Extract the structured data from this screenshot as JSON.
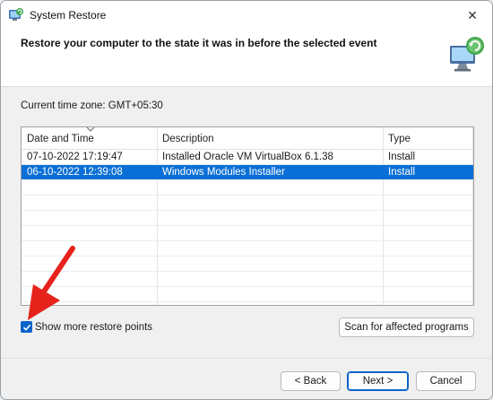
{
  "window": {
    "title": "System Restore",
    "close_glyph": "✕"
  },
  "header": {
    "text": "Restore your computer to the state it was in before the selected event"
  },
  "timezone": {
    "text": "Current time zone: GMT+05:30"
  },
  "table": {
    "headers": [
      "Date and Time",
      "Description",
      "Type"
    ],
    "rows": [
      {
        "date": "07-10-2022 17:19:47",
        "description": "Installed Oracle VM VirtualBox 6.1.38",
        "type": "Install",
        "selected": false
      },
      {
        "date": "06-10-2022 12:39:08",
        "description": "Windows Modules Installer",
        "type": "Install",
        "selected": true
      }
    ]
  },
  "checkbox": {
    "label": "Show more restore points",
    "checked": true
  },
  "buttons": {
    "scan": "Scan for affected programs",
    "back": "< Back",
    "next": "Next >",
    "cancel": "Cancel"
  },
  "icons": {
    "app": "system-restore-icon",
    "header": "computer-restore-icon",
    "close": "close-icon",
    "sort": "sort-caret-icon",
    "annotation": "red-arrow"
  },
  "colors": {
    "selection": "#0a6fd6",
    "accent": "#0a63c9",
    "annotation": "#e5231b"
  }
}
